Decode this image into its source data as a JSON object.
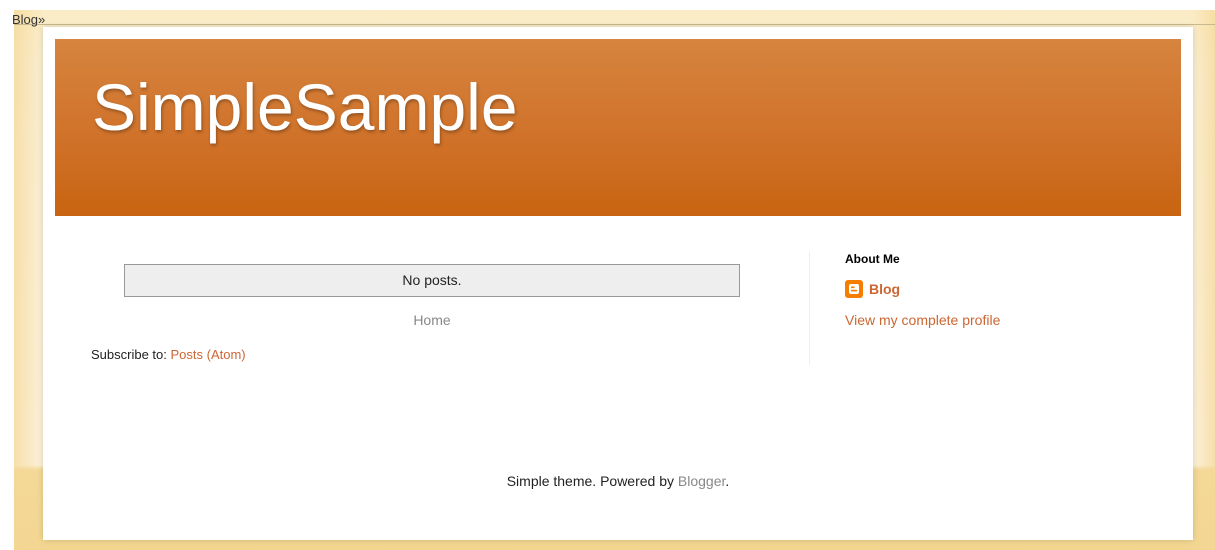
{
  "navbar": {
    "text": "Blog»"
  },
  "header": {
    "title": "SimpleSample"
  },
  "main": {
    "no_posts": "No posts.",
    "home_link": "Home",
    "subscribe_prefix": "Subscribe to: ",
    "subscribe_link": "Posts (Atom)"
  },
  "sidebar": {
    "title": "About Me",
    "profile_icon": "blogger-icon",
    "profile_name": "Blog",
    "view_profile": "View my complete profile"
  },
  "footer": {
    "prefix": "Simple theme. Powered by ",
    "link": "Blogger",
    "suffix": "."
  },
  "colors": {
    "header_top": "#d6843f",
    "header_bottom": "#c86411",
    "link": "#cc6633",
    "blogger_orange": "#f57d00"
  }
}
